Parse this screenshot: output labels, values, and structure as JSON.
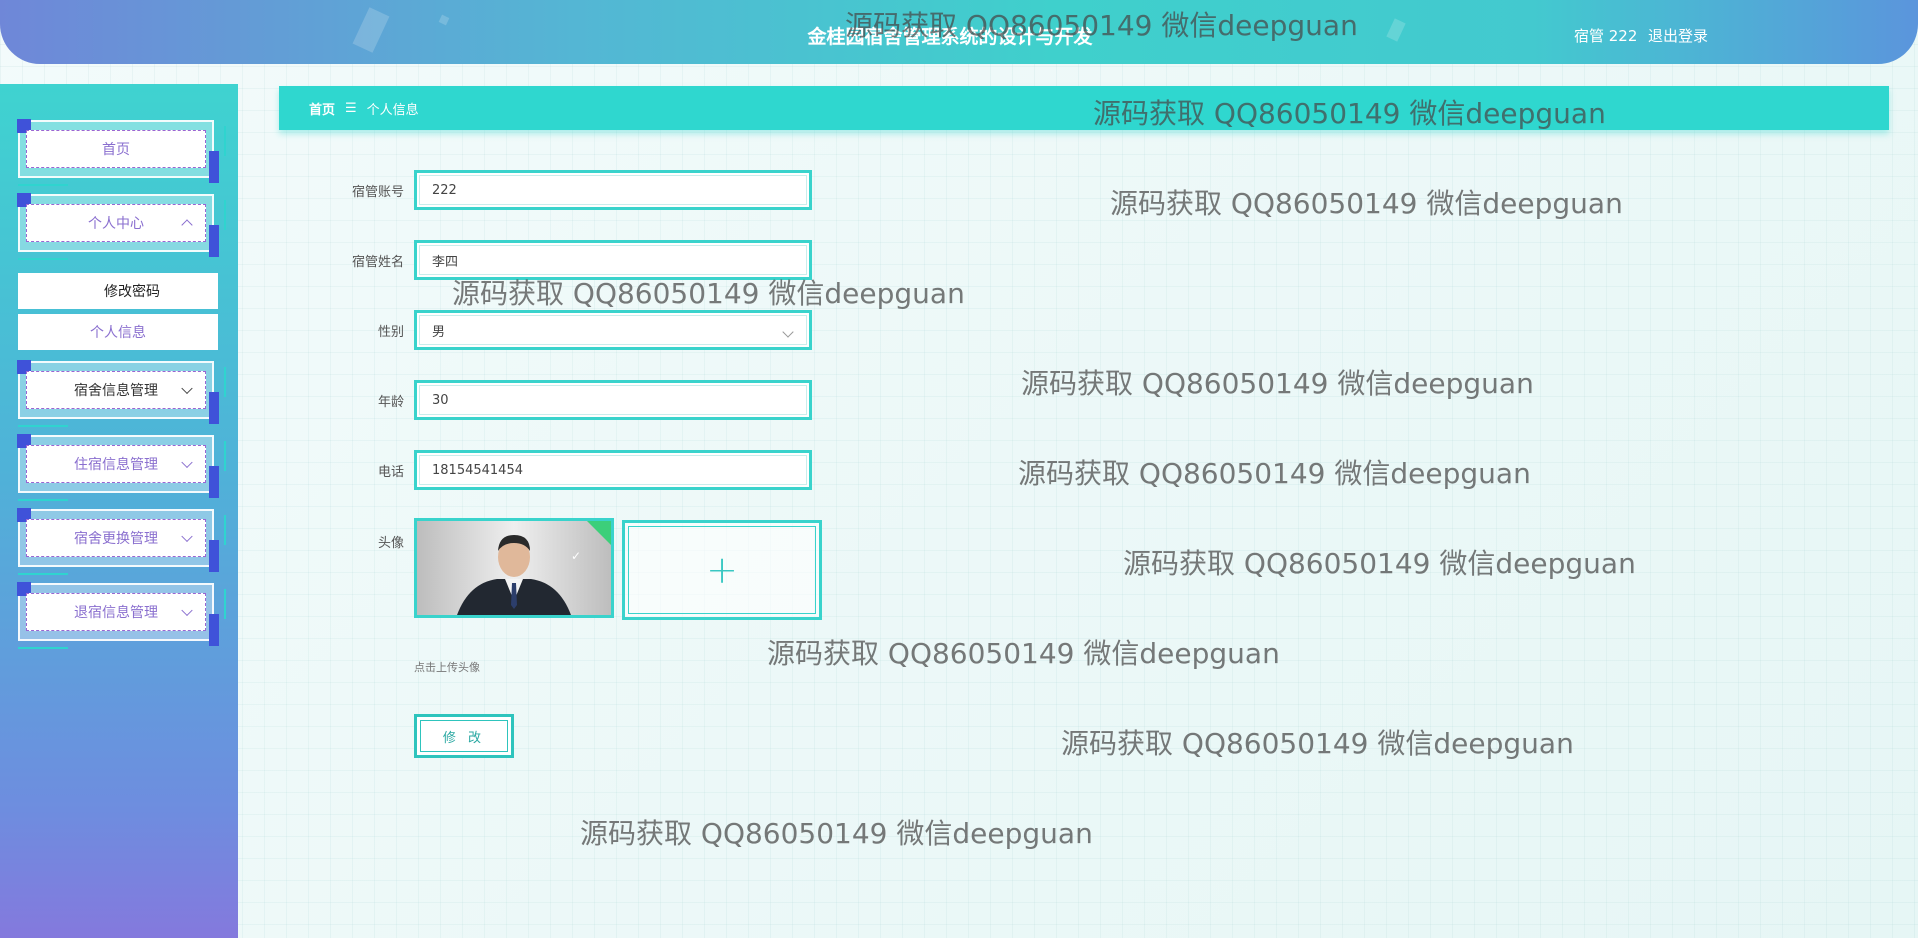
{
  "header": {
    "title": "金桂园宿舍管理系统的设计与开发",
    "user_label": "宿管 222",
    "logout": "退出登录"
  },
  "sidebar": {
    "items": [
      {
        "label": "首页"
      },
      {
        "label": "个人中心"
      },
      {
        "label": "宿舍信息管理"
      },
      {
        "label": "住宿信息管理"
      },
      {
        "label": "宿舍更换管理"
      },
      {
        "label": "退宿信息管理"
      }
    ],
    "submenu": [
      {
        "label": "修改密码"
      },
      {
        "label": "个人信息"
      }
    ]
  },
  "breadcrumb": {
    "home": "首页",
    "separator": "☰",
    "current": "个人信息"
  },
  "form": {
    "account_label": "宿管账号",
    "account_value": "222",
    "name_label": "宿管姓名",
    "name_value": "李四",
    "gender_label": "性别",
    "gender_value": "男",
    "age_label": "年龄",
    "age_value": "30",
    "phone_label": "电话",
    "phone_value": "18154541454",
    "avatar_label": "头像",
    "upload_symbol": "+",
    "upload_hint": "点击上传头像",
    "submit": "修 改"
  },
  "watermark": "源码获取 QQ86050149 微信deepguan",
  "colors": {
    "accent": "#2fd7cf",
    "sidebar_top": "#3fd3d0",
    "sidebar_bottom": "#8479dd",
    "corner": "#3f52d9"
  }
}
